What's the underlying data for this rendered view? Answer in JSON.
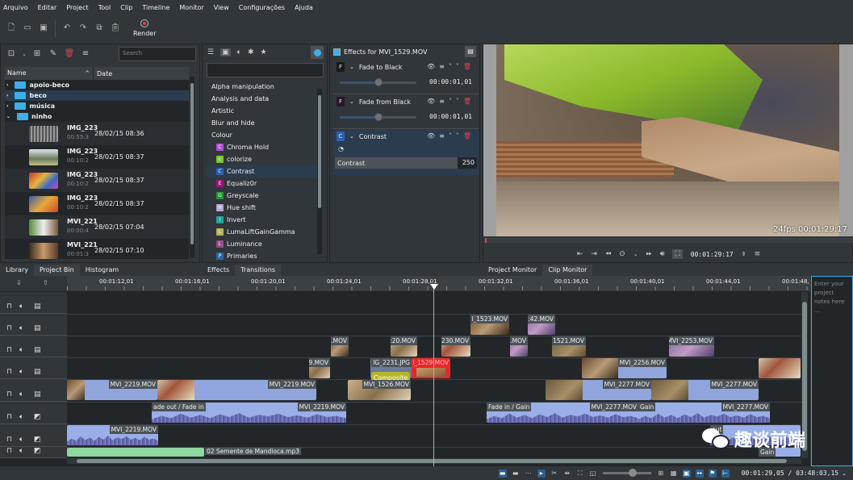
{
  "menu": [
    "Arquivo",
    "Editar",
    "Project",
    "Tool",
    "Clip",
    "Timeline",
    "Monitor",
    "View",
    "Configurações",
    "Ajuda"
  ],
  "toolbar": {
    "icons": [
      "new-document-icon",
      "open-folder-icon",
      "save-icon",
      "undo-icon",
      "redo-icon",
      "copy-icon",
      "paste-icon"
    ],
    "render_label": "Render"
  },
  "bin": {
    "search_placeholder": "Search",
    "columns": {
      "name": "Name",
      "date": "Date"
    },
    "folders": [
      {
        "name": "apoio-beco"
      },
      {
        "name": "beco",
        "selected": true
      },
      {
        "name": "música"
      },
      {
        "name": "ninho",
        "expanded": true
      }
    ],
    "clips": [
      {
        "name": "IMG_223",
        "duration": "00:55:3",
        "date": "28/02/15 08:36"
      },
      {
        "name": "IMG_223",
        "duration": "00:10:2",
        "date": "28/02/15 08:37"
      },
      {
        "name": "IMG_223",
        "duration": "00:10:2",
        "date": "28/02/15 08:37"
      },
      {
        "name": "IMG_223",
        "duration": "00:10:2",
        "date": "28/02/15 08:37"
      },
      {
        "name": "MVI_221",
        "duration": "00:00:4",
        "date": "28/02/15 07:04"
      },
      {
        "name": "MVI_221",
        "duration": "00:01:3",
        "date": "28/02/15 07:10"
      }
    ],
    "tabs": [
      "Library",
      "Project Bin",
      "Histogram"
    ]
  },
  "effects_list": {
    "categories": [
      "Alpha manipulation",
      "Analysis and data",
      "Artistic",
      "Blur and hide",
      "Colour"
    ],
    "items": [
      {
        "letter": "C",
        "name": "Chroma Hold",
        "color": "#b04fd6"
      },
      {
        "letter": "c",
        "name": "colorize",
        "color": "#7ac82f"
      },
      {
        "letter": "C",
        "name": "Contrast",
        "color": "#2d5fb0",
        "selected": true
      },
      {
        "letter": "E",
        "name": "Equaliz0r",
        "color": "#a0157f"
      },
      {
        "letter": "G",
        "name": "Greyscale",
        "color": "#1f9a2f"
      },
      {
        "letter": "H",
        "name": "Hue shift",
        "color": "#b4a8d8"
      },
      {
        "letter": "I",
        "name": "Invert",
        "color": "#1fa39a"
      },
      {
        "letter": "L",
        "name": "LumaLiftGainGamma",
        "color": "#b5b55a"
      },
      {
        "letter": "L",
        "name": "Luminance",
        "color": "#9a4a8a"
      },
      {
        "letter": "P",
        "name": "Primaries",
        "color": "#2a6aaa"
      }
    ],
    "tabs": [
      "Effects",
      "Transitions"
    ]
  },
  "effect_stack": {
    "title": "Effects for MVI_1529.MOV",
    "effects": [
      {
        "letter": "F",
        "name": "Fade to Black",
        "duration": "00:00:01,01",
        "slider": 0.5
      },
      {
        "letter": "F",
        "name": "Fade from Black",
        "duration": "00:00:01,01",
        "slider": 0.5
      },
      {
        "letter": "C",
        "name": "Contrast",
        "param": "Contrast",
        "value": "250"
      }
    ]
  },
  "monitor": {
    "overlay": "24fps 00:01:29:17",
    "timecode": "00:01:29:17",
    "tabs": [
      "Project Monitor",
      "Clip Monitor"
    ]
  },
  "timeline": {
    "ruler": [
      "00:01:12,01",
      "00:01:16,01",
      "00:01:20,01",
      "00:01:24,01",
      "00:01:28,01",
      "00:01:32,01",
      "00:01:36,01",
      "00:01:40,01",
      "00:01:44,01",
      "00:01:48,"
    ],
    "clips": {
      "v5a": "l_1523.MOV",
      "v5b": ":42.MOV",
      "v4a": ".MOV",
      "v4b": ":20.MOV",
      "v4c": "230.MOV",
      "v4d": ".MOV",
      "v4e": "1521.MOV",
      "v4f": "MVI_2253.MOV",
      "v3a": "9.MOV",
      "v3b": "IG_2231.JPG",
      "v3c": "l_1529.MOV",
      "v3d": "MVI_2256.MOV",
      "v2a": "MVI_2219.MOV",
      "v2b": "MVI_2219.MOV",
      "v2c": "MVI_1526.MOV",
      "v2d": "MVI_2277.MOV",
      "v2e": "MVI_2277.MOV",
      "a1a": "ade out / Fade in",
      "a1b": "MVI_2219.MOV",
      "a1c": "Fade in / Gain",
      "a1d": "MVI_2277.MOV",
      "a1e": "Gain",
      "a1f": "MVI_2277.MOV",
      "a2a": "MVI_2219.MOV",
      "a2b": "out",
      "a3a": "02 Semente de Mandioca.mp3",
      "a3b": "Gain"
    },
    "composite_label": "Composite",
    "notes_placeholder": "Enter your project notes here ..."
  },
  "status": {
    "timecode": "00:01:29,05 / 03:48:03,15"
  },
  "watermark": "趣谈前端"
}
